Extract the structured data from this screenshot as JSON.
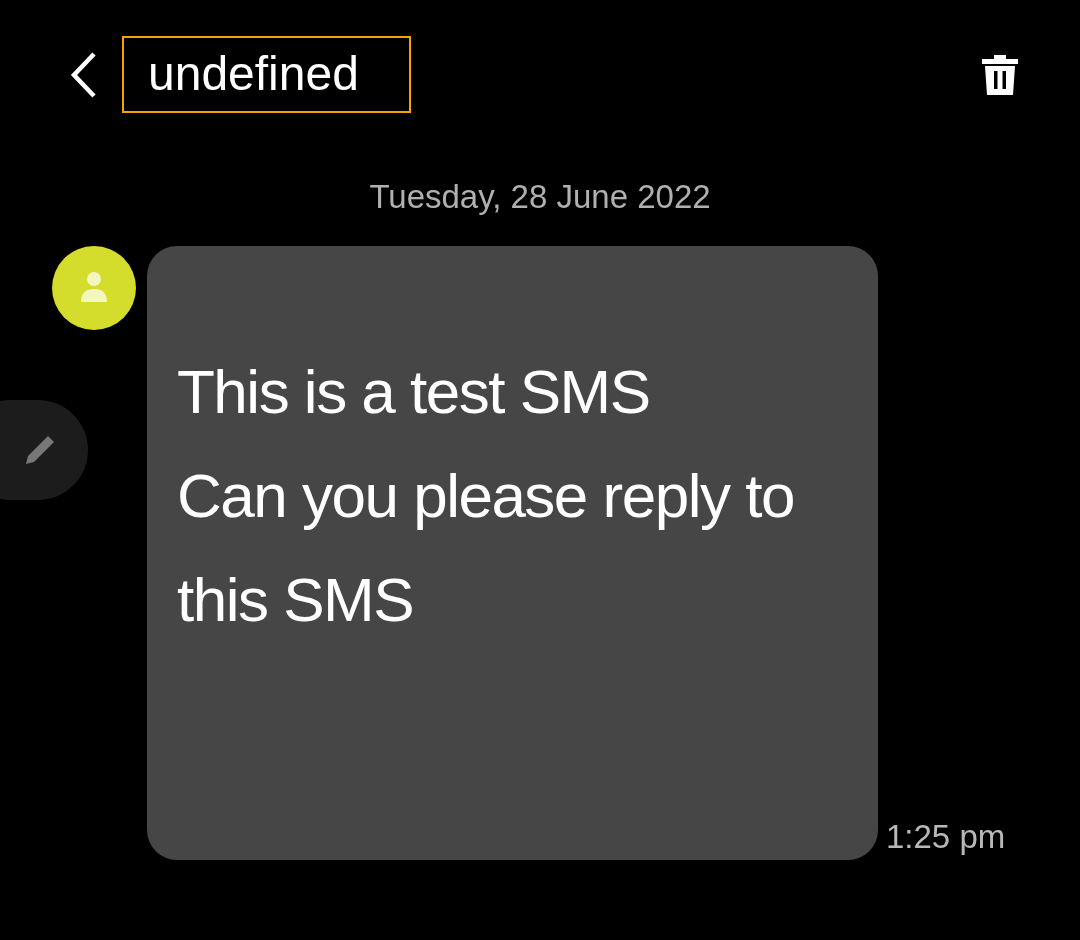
{
  "header": {
    "title": "undefined"
  },
  "date_separator": "Tuesday, 28 June 2022",
  "messages": [
    {
      "text": "This is a test SMS\nCan you please reply to\nthis SMS",
      "time": "1:25 pm"
    }
  ]
}
